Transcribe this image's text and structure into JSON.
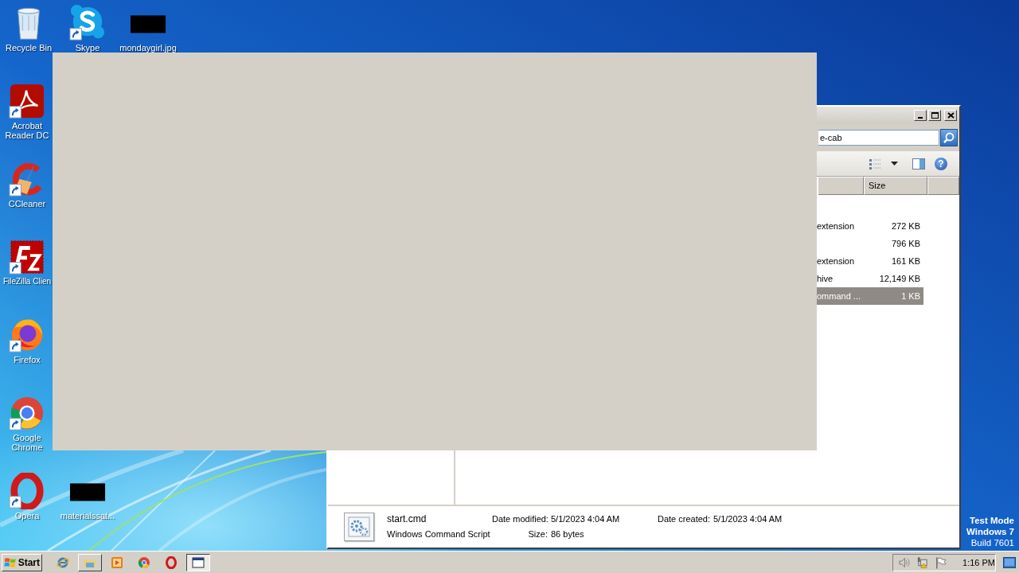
{
  "desktop_icons": [
    {
      "label": "Recycle Bin",
      "kind": "recycle-bin",
      "shortcut": false
    },
    {
      "label": "Skype",
      "kind": "skype",
      "shortcut": true
    },
    {
      "label": "mondaygirl.jpg",
      "kind": "redacted",
      "shortcut": false
    },
    {
      "label": "Acrobat Reader DC",
      "kind": "acrobat",
      "shortcut": true
    },
    {
      "label": "CCleaner",
      "kind": "ccleaner",
      "shortcut": true
    },
    {
      "label": "FileZilla Clien",
      "kind": "filezilla",
      "shortcut": true
    },
    {
      "label": "Firefox",
      "kind": "firefox",
      "shortcut": true
    },
    {
      "label": "Google Chrome",
      "kind": "chrome",
      "shortcut": true
    },
    {
      "label": "Opera",
      "kind": "opera",
      "shortcut": true
    },
    {
      "label": "materialssat...",
      "kind": "redacted",
      "shortcut": false
    }
  ],
  "explorer": {
    "address": "e-cab",
    "help": "?",
    "columns": [
      {
        "label": "Size"
      }
    ],
    "files": [
      {
        "type": "extension",
        "size": "272 KB",
        "selected": false
      },
      {
        "size": "796 KB",
        "selected": false
      },
      {
        "type": "extension",
        "size": "161 KB",
        "selected": false
      },
      {
        "type": "hive",
        "size": "12,149 KB",
        "selected": false
      },
      {
        "type": "ommand ...",
        "size": "1 KB",
        "selected": true
      }
    ],
    "details": {
      "name": "start.cmd",
      "type": "Windows Command Script",
      "fields": [
        {
          "label": "Date modified:",
          "value": "5/1/2023 4:04 AM"
        },
        {
          "label": "Size:",
          "value": "86 bytes"
        },
        {
          "label": "Date created:",
          "value": "5/1/2023 4:04 AM"
        }
      ]
    }
  },
  "os_notice": [
    {
      "text": "Test Mode",
      "bold": true
    },
    {
      "text": "Windows 7",
      "bold": true
    },
    {
      "text": "Build 7601",
      "bold": false
    }
  ],
  "taskbar": {
    "start": "Start",
    "buttons": [
      {
        "kind": "ie",
        "task": false,
        "selected": false
      },
      {
        "kind": "explorer",
        "task": true,
        "selected": false
      },
      {
        "kind": "media-player",
        "task": false,
        "selected": false
      },
      {
        "kind": "chrome",
        "task": false,
        "selected": false
      },
      {
        "kind": "opera",
        "task": false,
        "selected": false
      },
      {
        "kind": "window",
        "task": true,
        "selected": true
      }
    ],
    "time": "1:16 PM"
  }
}
